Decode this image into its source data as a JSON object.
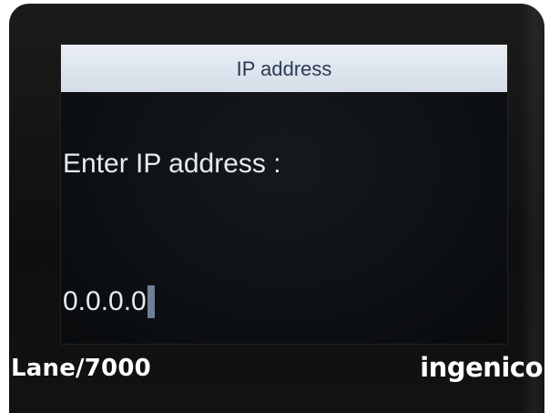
{
  "screen": {
    "title": "IP address",
    "prompt": "Enter IP address :",
    "input_value": "0.0.0.0"
  },
  "device": {
    "model": "Lane/7000",
    "brand": "ingenico"
  },
  "colors": {
    "title_bar": "#dfe6ee",
    "title_text": "#2a3a52",
    "screen_bg": "#0c0f12",
    "screen_text": "#e8eaee",
    "cursor": "#6f7f97",
    "bezel": "#151515"
  }
}
